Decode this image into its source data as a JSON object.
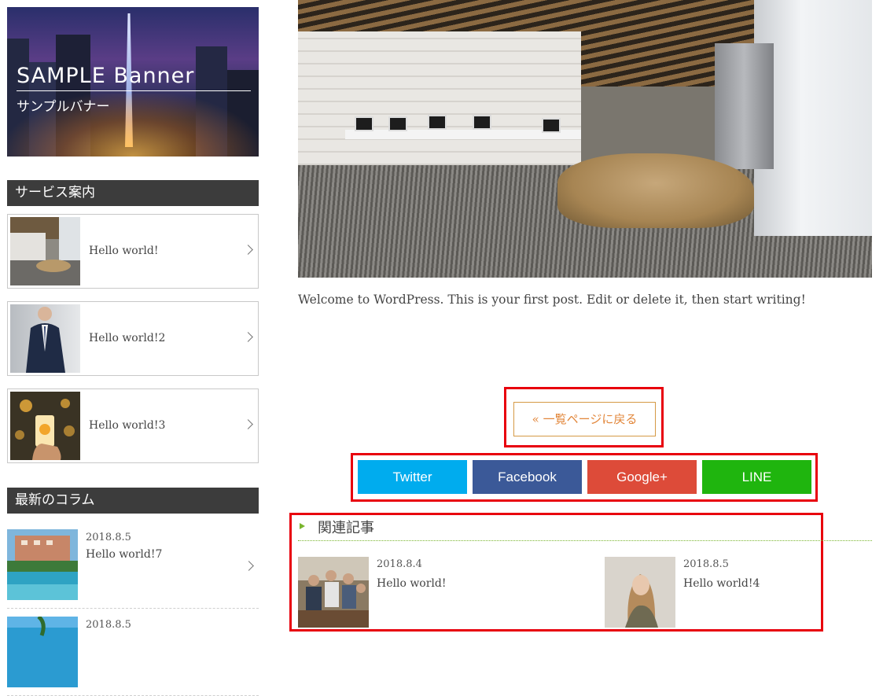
{
  "banner": {
    "title": "SAMPLE Banner",
    "subtitle": "サンプルバナー"
  },
  "services": {
    "heading": "サービス案内",
    "items": [
      {
        "label": "Hello world!"
      },
      {
        "label": "Hello world!2"
      },
      {
        "label": "Hello world!3"
      }
    ]
  },
  "columns": {
    "heading": "最新のコラム",
    "items": [
      {
        "date": "2018.8.5",
        "title": "Hello world!7"
      },
      {
        "date": "2018.8.5",
        "title": ""
      }
    ]
  },
  "post": {
    "text": "Welcome to WordPress. This is your first post. Edit or delete it, then start writing!"
  },
  "nav": {
    "back_label": "« 一覧ページに戻る"
  },
  "share": {
    "twitter": "Twitter",
    "facebook": "Facebook",
    "google": "Google+",
    "line": "LINE"
  },
  "colors": {
    "twitter": "#00acee",
    "facebook": "#3b5998",
    "google": "#dd4b39",
    "line": "#1fb50e",
    "highlight": "#e8000d",
    "accent_green": "#7ab52e"
  },
  "related": {
    "heading": "関連記事",
    "items": [
      {
        "date": "2018.8.4",
        "title": "Hello world!"
      },
      {
        "date": "2018.8.5",
        "title": "Hello world!4"
      }
    ]
  }
}
